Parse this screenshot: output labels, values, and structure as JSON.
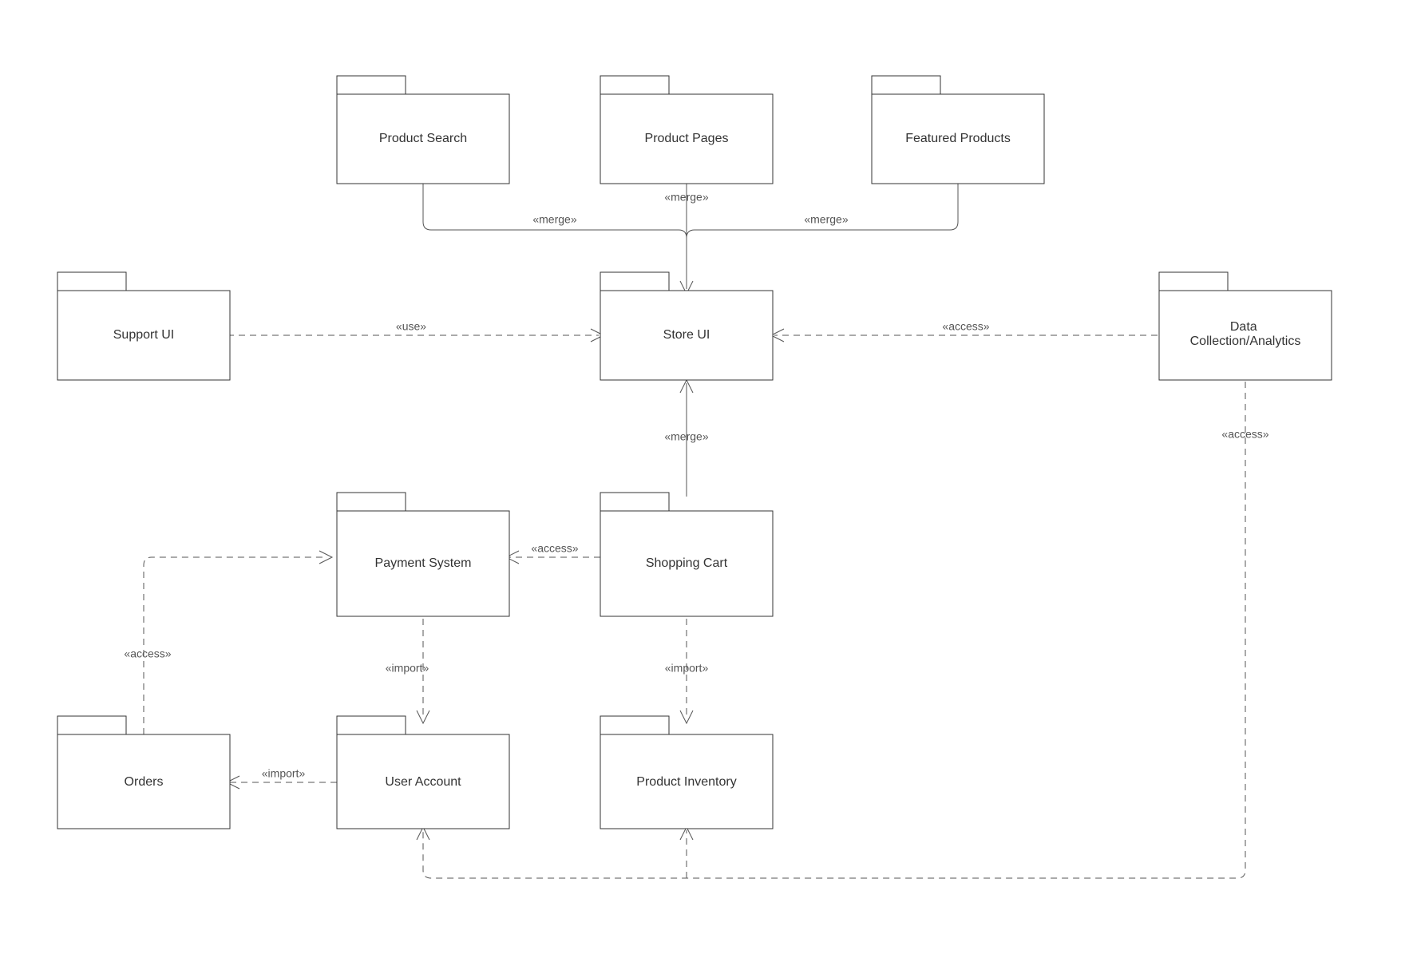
{
  "diagram": {
    "type": "uml-package-diagram",
    "packages": {
      "product_search": {
        "label": "Product Search"
      },
      "product_pages": {
        "label": "Product Pages"
      },
      "featured_products": {
        "label": "Featured Products"
      },
      "support_ui": {
        "label": "Support UI"
      },
      "store_ui": {
        "label": "Store UI"
      },
      "data_analytics": {
        "label": "Data\nCollection/Analytics"
      },
      "payment_system": {
        "label": "Payment System"
      },
      "shopping_cart": {
        "label": "Shopping Cart"
      },
      "orders": {
        "label": "Orders"
      },
      "user_account": {
        "label": "User Account"
      },
      "product_inventory": {
        "label": "Product Inventory"
      }
    },
    "relationships": {
      "ps_merge": {
        "label": "«merge»",
        "from": "product_search",
        "to": "store_ui"
      },
      "pp_merge": {
        "label": "«merge»",
        "from": "product_pages",
        "to": "store_ui"
      },
      "fp_merge": {
        "label": "«merge»",
        "from": "featured_products",
        "to": "store_ui"
      },
      "support_use": {
        "label": "«use»",
        "from": "support_ui",
        "to": "store_ui"
      },
      "da_store": {
        "label": "«access»",
        "from": "data_analytics",
        "to": "store_ui"
      },
      "sc_merge": {
        "label": "«merge»",
        "from": "shopping_cart",
        "to": "store_ui"
      },
      "sc_pay": {
        "label": "«access»",
        "from": "shopping_cart",
        "to": "payment_system"
      },
      "pay_user": {
        "label": "«import»",
        "from": "payment_system",
        "to": "user_account"
      },
      "sc_inv": {
        "label": "«import»",
        "from": "shopping_cart",
        "to": "product_inventory"
      },
      "user_orders": {
        "label": "«import»",
        "from": "user_account",
        "to": "orders"
      },
      "orders_pay": {
        "label": "«access»",
        "from": "orders",
        "to": "payment_system"
      },
      "da_user_inv": {
        "label": "«access»",
        "from": "data_analytics",
        "to": "user_account,product_inventory"
      }
    }
  }
}
